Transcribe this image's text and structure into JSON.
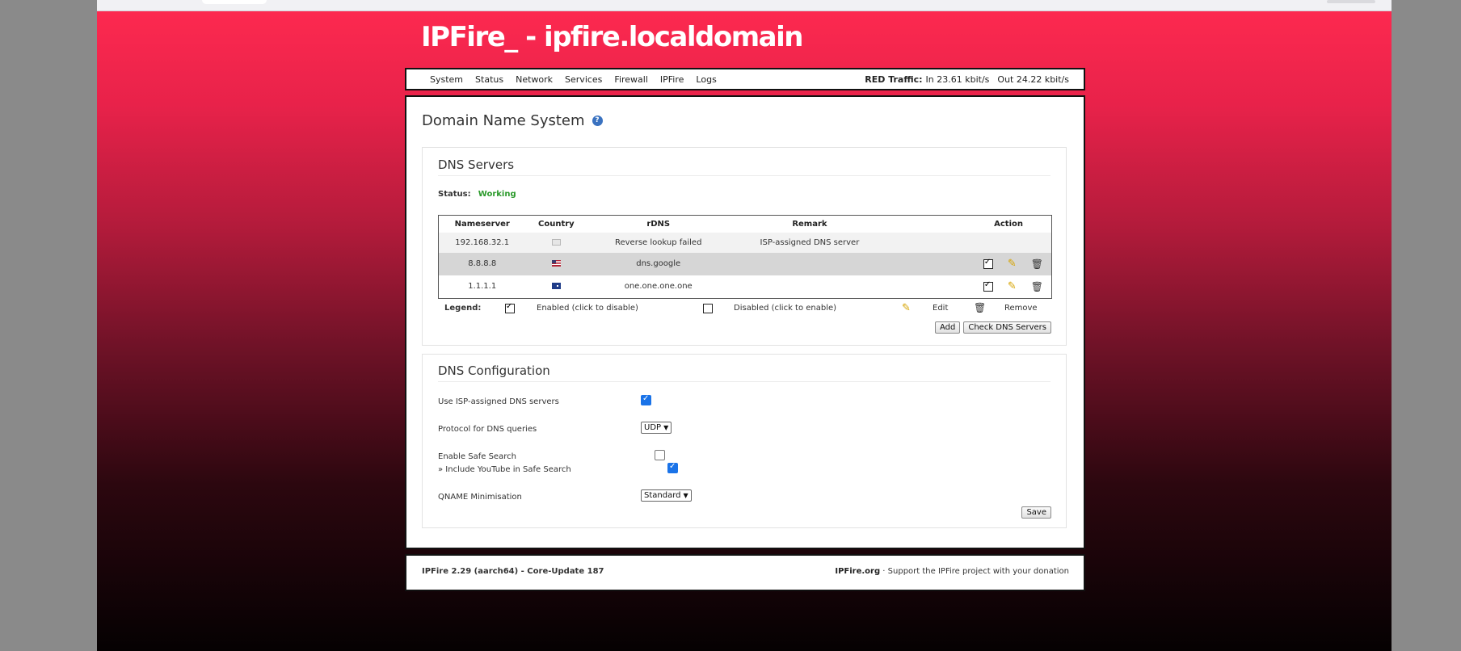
{
  "banner": {
    "title": "IPFire_ - ipfire.localdomain"
  },
  "menu": {
    "items": [
      {
        "label": "System"
      },
      {
        "label": "Status"
      },
      {
        "label": "Network"
      },
      {
        "label": "Services"
      },
      {
        "label": "Firewall"
      },
      {
        "label": "IPFire"
      },
      {
        "label": "Logs"
      }
    ],
    "traffic": {
      "label": "RED Traffic:",
      "in": "In 23.61 kbit/s",
      "out": "Out 24.22 kbit/s"
    }
  },
  "page": {
    "title": "Domain Name System",
    "help_icon": "?"
  },
  "dns_servers": {
    "heading": "DNS Servers",
    "status_label": "Status:",
    "status_value": "Working",
    "columns": {
      "nameserver": "Nameserver",
      "country": "Country",
      "rdns": "rDNS",
      "remark": "Remark",
      "action": "Action"
    },
    "rows": [
      {
        "nameserver": "192.168.32.1",
        "country_icon": "unknown-flag",
        "rdns": "Reverse lookup failed",
        "remark": "ISP-assigned DNS server"
      },
      {
        "nameserver": "8.8.8.8",
        "country_icon": "us-flag",
        "rdns": "dns.google",
        "remark": ""
      },
      {
        "nameserver": "1.1.1.1",
        "country_icon": "au-flag",
        "rdns": "one.one.one.one",
        "remark": ""
      }
    ],
    "legend": {
      "label": "Legend:",
      "enabled": "Enabled (click to disable)",
      "disabled": "Disabled (click to enable)",
      "edit": "Edit",
      "remove": "Remove"
    },
    "add_button": "Add",
    "check_button": "Check DNS Servers"
  },
  "dns_config": {
    "heading": "DNS Configuration",
    "use_isp_label": "Use ISP-assigned DNS servers",
    "use_isp_checked": true,
    "protocol_label": "Protocol for DNS queries",
    "protocol_value": "UDP",
    "safe_search_label": "Enable Safe Search",
    "safe_search_checked": false,
    "youtube_label": "» Include YouTube in Safe Search",
    "youtube_checked": true,
    "qname_label": "QNAME Minimisation",
    "qname_value": "Standard",
    "save_button": "Save"
  },
  "footer": {
    "left": "IPFire 2.29 (aarch64) - Core-Update 187",
    "right_site": "IPFire.org",
    "right_text": " · Support the IPFire project with your donation"
  }
}
